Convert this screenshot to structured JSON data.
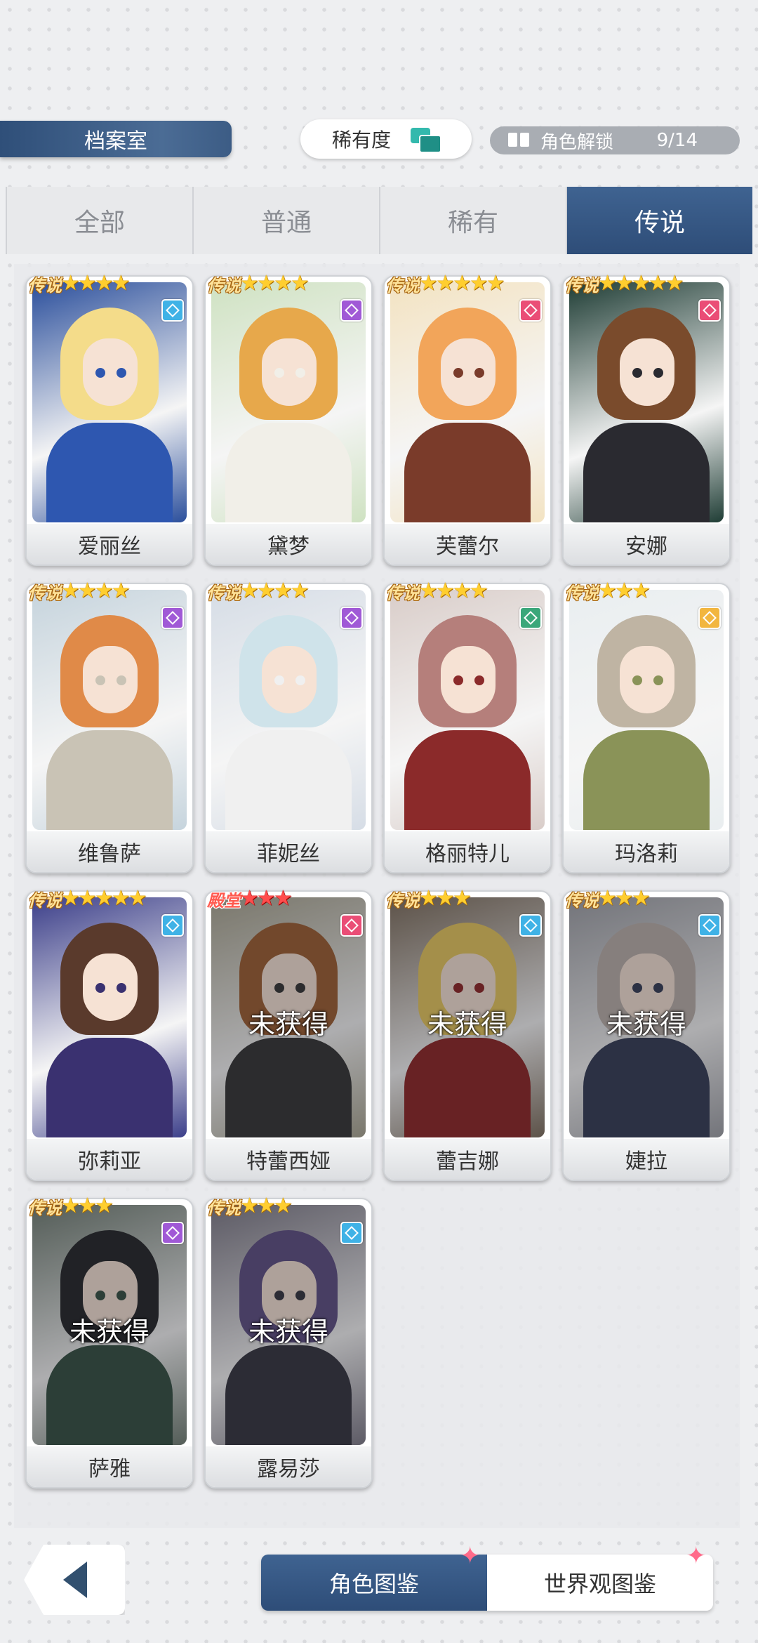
{
  "header": {
    "title": "档案室"
  },
  "sort": {
    "label": "稀有度"
  },
  "unlock": {
    "label": "角色解锁",
    "count": "9/14"
  },
  "tabs": [
    {
      "label": "全部",
      "active": false
    },
    {
      "label": "普通",
      "active": false
    },
    {
      "label": "稀有",
      "active": false
    },
    {
      "label": "传说",
      "active": true
    }
  ],
  "locked_label": "未获得",
  "characters": [
    {
      "name": "爱丽丝",
      "tag": "传说",
      "stars": 4,
      "attr": "ice",
      "attr_color": "#3fb2e6",
      "owned": true,
      "palette": [
        "#2b4f9c",
        "#f4dc8a",
        "#2e57b0"
      ]
    },
    {
      "name": "黛梦",
      "tag": "传说",
      "stars": 4,
      "attr": "wind",
      "attr_color": "#a059d6",
      "owned": true,
      "palette": [
        "#cfe2c2",
        "#e7a84b",
        "#f1efe8"
      ]
    },
    {
      "name": "芙蕾尔",
      "tag": "传说",
      "stars": 5,
      "attr": "fire",
      "attr_color": "#ea4d76",
      "owned": true,
      "palette": [
        "#f3e3c2",
        "#f2a55a",
        "#7a3b2a"
      ]
    },
    {
      "name": "安娜",
      "tag": "传说",
      "stars": 5,
      "attr": "fire",
      "attr_color": "#ea4d76",
      "owned": true,
      "palette": [
        "#1f3d35",
        "#7a4b2c",
        "#2a2a30"
      ]
    },
    {
      "name": "维鲁萨",
      "tag": "传说",
      "stars": 4,
      "attr": "wind",
      "attr_color": "#a059d6",
      "owned": true,
      "palette": [
        "#c6d4dd",
        "#e08a48",
        "#c9c3b5"
      ]
    },
    {
      "name": "菲妮丝",
      "tag": "传说",
      "stars": 4,
      "attr": "wind",
      "attr_color": "#a059d6",
      "owned": true,
      "palette": [
        "#d6dde6",
        "#cfe3ea",
        "#f0f0f0"
      ]
    },
    {
      "name": "格丽特儿",
      "tag": "传说",
      "stars": 4,
      "attr": "earth",
      "attr_color": "#3aa77a",
      "owned": true,
      "palette": [
        "#d9cdc9",
        "#b57f7b",
        "#8b2a2a"
      ]
    },
    {
      "name": "玛洛莉",
      "tag": "传说",
      "stars": 3,
      "attr": "light",
      "attr_color": "#f2b63f",
      "owned": true,
      "palette": [
        "#e9eef0",
        "#bfb4a3",
        "#8a9358"
      ]
    },
    {
      "name": "弥莉亚",
      "tag": "传说",
      "stars": 5,
      "attr": "ice",
      "attr_color": "#3fb2e6",
      "owned": true,
      "palette": [
        "#3c3f8a",
        "#5a3a2c",
        "#3a3170"
      ]
    },
    {
      "name": "特蕾西娅",
      "tag": "殿堂",
      "stars": 3,
      "attr": "fire",
      "attr_color": "#ea4d76",
      "owned": false,
      "palette": [
        "#a7a38e",
        "#9a5a2c",
        "#2f2f2f"
      ]
    },
    {
      "name": "蕾吉娜",
      "tag": "传说",
      "stars": 3,
      "attr": "ice",
      "attr_color": "#3fb2e6",
      "owned": false,
      "palette": [
        "#7a6a58",
        "#e7c65a",
        "#8a1f1f"
      ]
    },
    {
      "name": "婕拉",
      "tag": "传说",
      "stars": 3,
      "attr": "ice",
      "attr_color": "#3fb2e6",
      "owned": false,
      "palette": [
        "#9c9ea4",
        "#b9aea8",
        "#2f3650"
      ]
    },
    {
      "name": "萨雅",
      "tag": "传说",
      "stars": 3,
      "attr": "wind",
      "attr_color": "#a059d6",
      "owned": false,
      "palette": [
        "#6d7b70",
        "#1e1f22",
        "#2e4a3c"
      ]
    },
    {
      "name": "露易莎",
      "tag": "传说",
      "stars": 3,
      "attr": "ice",
      "attr_color": "#3fb2e6",
      "owned": false,
      "palette": [
        "#7a7784",
        "#5a4a80",
        "#2f2f3a"
      ]
    }
  ],
  "bottom_tabs": [
    {
      "label": "角色图鉴",
      "active": true
    },
    {
      "label": "世界观图鉴",
      "active": false
    }
  ]
}
